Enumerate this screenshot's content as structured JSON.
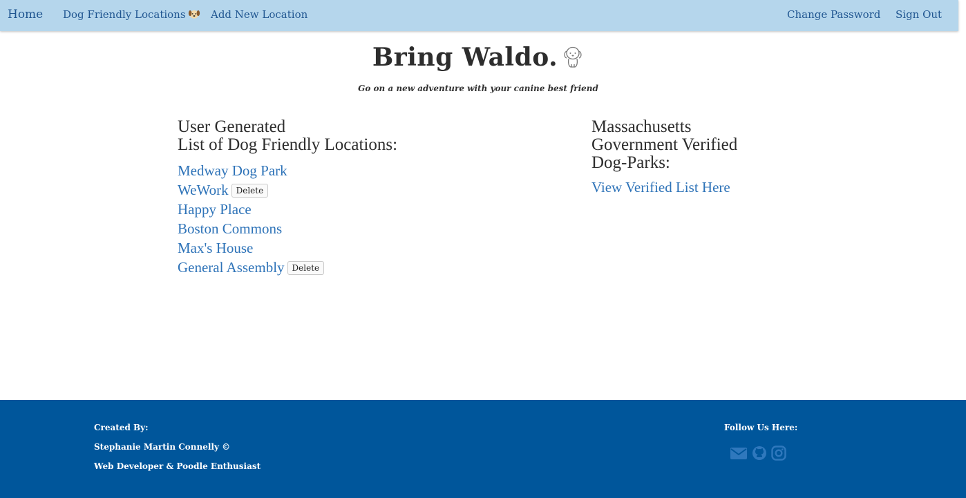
{
  "nav": {
    "home": "Home",
    "locations": "Dog Friendly Locations",
    "add": "Add New Location",
    "change_password": "Change Password",
    "sign_out": "Sign Out"
  },
  "header": {
    "title": "Bring Waldo.",
    "tagline": "Go on a new adventure with your canine best friend"
  },
  "left": {
    "heading_line1": "User Generated",
    "heading_line2": "List of Dog Friendly Locations:",
    "locations": [
      {
        "name": "Medway Dog Park",
        "deletable": false
      },
      {
        "name": "WeWork",
        "deletable": true
      },
      {
        "name": "Happy Place",
        "deletable": false
      },
      {
        "name": "Boston Commons",
        "deletable": false
      },
      {
        "name": "Max's House",
        "deletable": false
      },
      {
        "name": "General Assembly",
        "deletable": true
      }
    ],
    "delete_label": "Delete"
  },
  "right": {
    "heading_line1": "Massachusetts",
    "heading_line2": "Government Verified",
    "heading_line3": "Dog-Parks:",
    "link": "View Verified List Here"
  },
  "footer": {
    "created_by": "Created By:",
    "name": "Stephanie Martin Connelly ©",
    "role": "Web Developer & Poodle Enthusiast",
    "follow": "Follow Us Here:",
    "social_icons": [
      "envelope-icon",
      "github-icon",
      "instagram-icon"
    ]
  },
  "colors": {
    "navbar": "#b5d6ec",
    "nav_link": "#1f5590",
    "link": "#2e73b8",
    "footer": "#00569b",
    "social_icon": "#2f78bd"
  }
}
